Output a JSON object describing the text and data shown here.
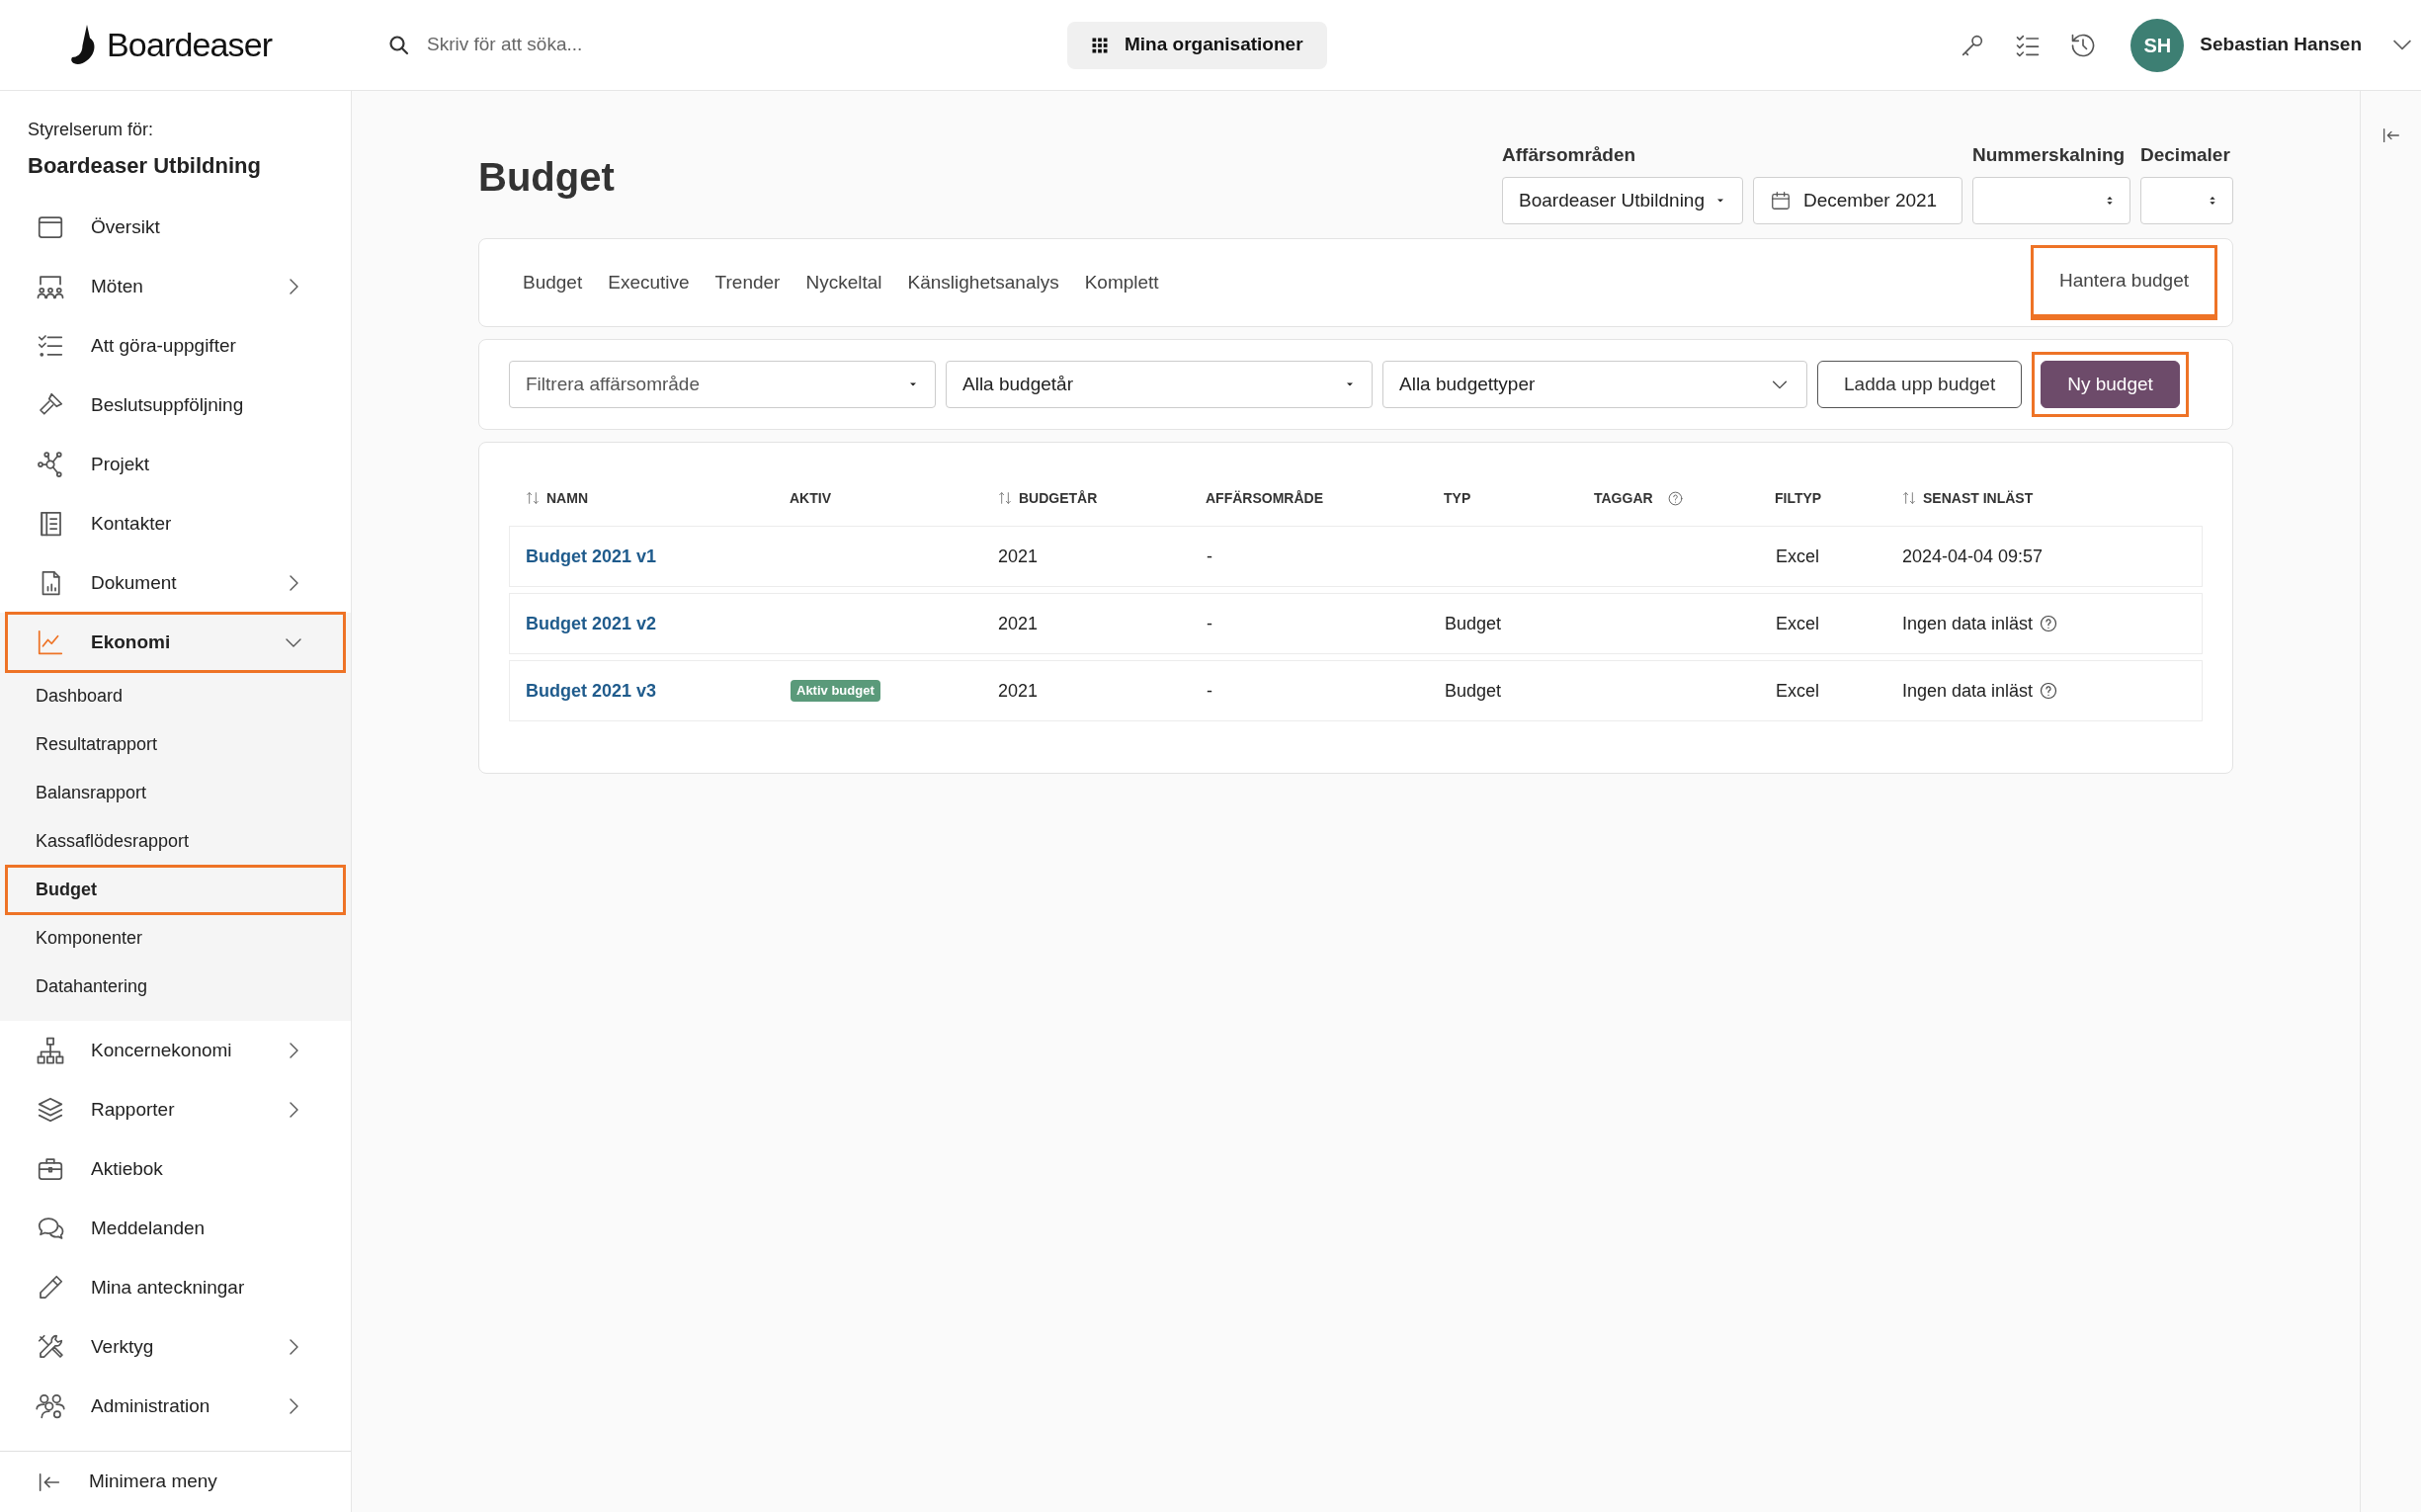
{
  "header": {
    "logo": "Boardeaser",
    "search": {
      "placeholder": "Skriv för att söka..."
    },
    "org_button": "Mina organisationer",
    "user": {
      "initials": "SH",
      "name": "Sebastian Hansen"
    }
  },
  "sidebar": {
    "caption": "Styrelserum för:",
    "org": "Boardeaser Utbildning",
    "items": [
      {
        "label": "Översikt",
        "expandable": false,
        "active": false,
        "highlighted": false
      },
      {
        "label": "Möten",
        "expandable": true,
        "expanded": false,
        "active": false,
        "highlighted": false
      },
      {
        "label": "Att göra-uppgifter",
        "expandable": false,
        "active": false,
        "highlighted": false
      },
      {
        "label": "Beslutsuppföljning",
        "expandable": false,
        "active": false,
        "highlighted": false
      },
      {
        "label": "Projekt",
        "expandable": false,
        "active": false,
        "highlighted": false
      },
      {
        "label": "Kontakter",
        "expandable": false,
        "active": false,
        "highlighted": false
      },
      {
        "label": "Dokument",
        "expandable": true,
        "expanded": false,
        "active": false,
        "highlighted": false
      },
      {
        "label": "Ekonomi",
        "expandable": true,
        "expanded": true,
        "active": true,
        "highlighted": true,
        "children": [
          {
            "label": "Dashboard",
            "selected": false,
            "highlighted": false
          },
          {
            "label": "Resultatrapport",
            "selected": false,
            "highlighted": false
          },
          {
            "label": "Balansrapport",
            "selected": false,
            "highlighted": false
          },
          {
            "label": "Kassaflödesrapport",
            "selected": false,
            "highlighted": false
          },
          {
            "label": "Budget",
            "selected": true,
            "highlighted": true
          },
          {
            "label": "Komponenter",
            "selected": false,
            "highlighted": false
          },
          {
            "label": "Datahantering",
            "selected": false,
            "highlighted": false
          }
        ]
      },
      {
        "label": "Koncernekonomi",
        "expandable": true,
        "expanded": false,
        "active": false,
        "highlighted": false
      },
      {
        "label": "Rapporter",
        "expandable": true,
        "expanded": false,
        "active": false,
        "highlighted": false
      },
      {
        "label": "Aktiebok",
        "expandable": false,
        "active": false,
        "highlighted": false
      },
      {
        "label": "Meddelanden",
        "expandable": false,
        "active": false,
        "highlighted": false
      },
      {
        "label": "Mina anteckningar",
        "expandable": false,
        "active": false,
        "highlighted": false
      },
      {
        "label": "Verktyg",
        "expandable": true,
        "expanded": false,
        "active": false,
        "highlighted": false
      },
      {
        "label": "Administration",
        "expandable": true,
        "expanded": false,
        "active": false,
        "highlighted": false
      }
    ],
    "footer": "Minimera meny"
  },
  "page": {
    "title": "Budget",
    "controls": [
      {
        "label": "Affärsområden",
        "kind": "select",
        "value": "Boardeaser Utbildning"
      },
      {
        "kind": "date",
        "value": "December 2021"
      },
      {
        "label": "Nummerskalning",
        "kind": "stepper"
      },
      {
        "label": "Decimaler",
        "kind": "stepper"
      }
    ]
  },
  "tabs": [
    {
      "label": "Budget",
      "selected": false,
      "highlighted": false
    },
    {
      "label": "Executive",
      "selected": false,
      "highlighted": false
    },
    {
      "label": "Trender",
      "selected": false,
      "highlighted": false
    },
    {
      "label": "Nyckeltal",
      "selected": false,
      "highlighted": false
    },
    {
      "label": "Känslighetsanalys",
      "selected": false,
      "highlighted": false
    },
    {
      "label": "Komplett",
      "selected": false,
      "highlighted": false
    },
    {
      "label": "Hantera budget",
      "selected": true,
      "highlighted": true
    }
  ],
  "filters": [
    {
      "placeholder": "Filtrera affärsområde",
      "kind": "caret"
    },
    {
      "value": "Alla budgetår",
      "kind": "caret"
    },
    {
      "value": "Alla budgettyper",
      "kind": "chevron"
    }
  ],
  "buttons": [
    {
      "label": "Ladda upp budget",
      "kind": "outline",
      "highlighted": false
    },
    {
      "label": "Ny budget",
      "kind": "primary",
      "highlighted": true
    }
  ],
  "table": {
    "columns": [
      {
        "label": "NAMN",
        "sortable": true,
        "info": false
      },
      {
        "label": "AKTIV",
        "sortable": false,
        "info": false
      },
      {
        "label": "BUDGETÅR",
        "sortable": true,
        "info": false
      },
      {
        "label": "AFFÄRSOMRÅDE",
        "sortable": false,
        "info": false
      },
      {
        "label": "TYP",
        "sortable": false,
        "info": false
      },
      {
        "label": "TAGGAR",
        "sortable": false,
        "info": true
      },
      {
        "label": "FILTYP",
        "sortable": false,
        "info": false
      },
      {
        "label": "SENAST INLÄST",
        "sortable": true,
        "info": false
      }
    ],
    "rows": [
      {
        "name": "Budget 2021 v1",
        "active_badge": null,
        "year": "2021",
        "area": "-",
        "type": null,
        "tags": null,
        "filetype": "Excel",
        "loaded": "2024-04-04 09:57",
        "loaded_info": false
      },
      {
        "name": "Budget 2021 v2",
        "active_badge": null,
        "year": "2021",
        "area": "-",
        "type": "Budget",
        "tags": null,
        "filetype": "Excel",
        "loaded": "Ingen data inläst",
        "loaded_info": true
      },
      {
        "name": "Budget 2021 v3",
        "active_badge": "Aktiv budget",
        "year": "2021",
        "area": "-",
        "type": "Budget",
        "tags": null,
        "filetype": "Excel",
        "loaded": "Ingen data inläst",
        "loaded_info": true
      }
    ]
  }
}
